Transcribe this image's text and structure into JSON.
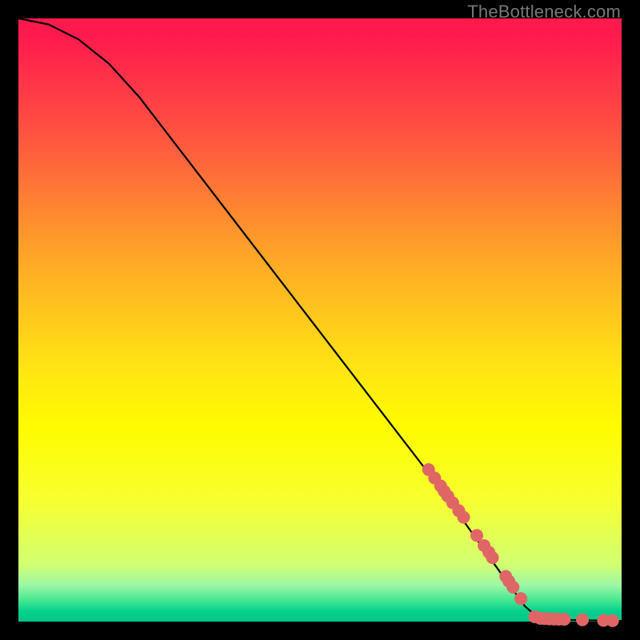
{
  "watermark": "TheBottleneck.com",
  "chart_data": {
    "type": "line",
    "title": "",
    "xlabel": "",
    "ylabel": "",
    "xlim": [
      0,
      100
    ],
    "ylim": [
      0,
      100
    ],
    "curve": [
      {
        "x": 0,
        "y": 100
      },
      {
        "x": 5,
        "y": 99
      },
      {
        "x": 10,
        "y": 96.5
      },
      {
        "x": 15,
        "y": 92.5
      },
      {
        "x": 20,
        "y": 87
      },
      {
        "x": 30,
        "y": 74
      },
      {
        "x": 40,
        "y": 61
      },
      {
        "x": 50,
        "y": 48
      },
      {
        "x": 60,
        "y": 35
      },
      {
        "x": 70,
        "y": 22
      },
      {
        "x": 75,
        "y": 15
      },
      {
        "x": 80,
        "y": 8
      },
      {
        "x": 84,
        "y": 2.5
      },
      {
        "x": 86,
        "y": 0.8
      },
      {
        "x": 90,
        "y": 0.3
      },
      {
        "x": 100,
        "y": 0.1
      }
    ],
    "scatter": [
      {
        "x": 68,
        "y": 25.2
      },
      {
        "x": 69,
        "y": 23.8
      },
      {
        "x": 70,
        "y": 22.5
      },
      {
        "x": 70.6,
        "y": 21.6
      },
      {
        "x": 71.2,
        "y": 20.8
      },
      {
        "x": 72,
        "y": 19.7
      },
      {
        "x": 73,
        "y": 18.4
      },
      {
        "x": 73.8,
        "y": 17.3
      },
      {
        "x": 76,
        "y": 14.3
      },
      {
        "x": 77.2,
        "y": 12.6
      },
      {
        "x": 78,
        "y": 11.5
      },
      {
        "x": 78.6,
        "y": 10.6
      },
      {
        "x": 80.8,
        "y": 7.5
      },
      {
        "x": 81.3,
        "y": 6.7
      },
      {
        "x": 82,
        "y": 5.7
      },
      {
        "x": 83.3,
        "y": 3.8
      },
      {
        "x": 85.6,
        "y": 0.8
      },
      {
        "x": 86.5,
        "y": 0.55
      },
      {
        "x": 87.2,
        "y": 0.5
      },
      {
        "x": 88,
        "y": 0.45
      },
      {
        "x": 88.8,
        "y": 0.42
      },
      {
        "x": 89.6,
        "y": 0.4
      },
      {
        "x": 90.5,
        "y": 0.38
      },
      {
        "x": 93.5,
        "y": 0.3
      },
      {
        "x": 97,
        "y": 0.2
      },
      {
        "x": 98.5,
        "y": 0.15
      }
    ],
    "scatter_color": "#e06666",
    "scatter_radius": 8
  }
}
